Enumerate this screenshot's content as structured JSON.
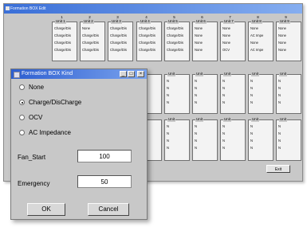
{
  "background_window": {
    "title": "Formation BOX Edit",
    "column_numbers": [
      "1",
      "2",
      "3",
      "4",
      "5",
      "6",
      "7",
      "8",
      "9"
    ],
    "top_units": [
      {
        "label": "Unit 1",
        "rows": [
          "Charge/Dis",
          "Charge/Dis",
          "Charge/Dis",
          "Charge/Dis"
        ]
      },
      {
        "label": "Unit 2",
        "rows": [
          "None",
          "Charge/Dis",
          "Charge/Dis",
          "Charge/Dis"
        ]
      },
      {
        "label": "Unit 3",
        "rows": [
          "Charge/Dis",
          "Charge/Dis",
          "Charge/Dis",
          "Charge/Dis"
        ]
      },
      {
        "label": "Unit 4",
        "rows": [
          "Charge/Dis",
          "Charge/Dis",
          "Charge/Dis",
          "Charge/Dis"
        ]
      },
      {
        "label": "Unit 5",
        "rows": [
          "Charge/Dis",
          "Charge/Dis",
          "Charge/Dis",
          "Charge/Dis"
        ]
      },
      {
        "label": "Unit 6",
        "rows": [
          "None",
          "None",
          "None",
          "None"
        ]
      },
      {
        "label": "Unit 7",
        "rows": [
          "None",
          "None",
          "None",
          "OCV"
        ]
      },
      {
        "label": "Unit 8",
        "rows": [
          "None",
          "AC Impe",
          "None",
          "AC Impe"
        ]
      },
      {
        "label": "Unit 9",
        "rows": [
          "None",
          "None",
          "None",
          "None"
        ]
      }
    ],
    "mid_units": [
      {
        "label": "Unit",
        "rows": [
          "N",
          "N",
          "N",
          "N"
        ]
      },
      {
        "label": "Unit",
        "rows": [
          "N",
          "N",
          "N",
          "N"
        ]
      },
      {
        "label": "Unit",
        "rows": [
          "N",
          "N",
          "N",
          "N"
        ]
      },
      {
        "label": "Unit",
        "rows": [
          "N",
          "N",
          "N",
          "N"
        ]
      },
      {
        "label": "Unit",
        "rows": [
          "N",
          "N",
          "N",
          "N"
        ]
      },
      {
        "label": "Unit",
        "rows": [
          "N",
          "N",
          "N",
          "N"
        ]
      }
    ],
    "low_units": [
      {
        "label": "Unit",
        "rows": [
          "N",
          "N",
          "N",
          "N"
        ]
      },
      {
        "label": "Unit",
        "rows": [
          "N",
          "N",
          "N",
          "N"
        ]
      },
      {
        "label": "Unit",
        "rows": [
          "N",
          "N",
          "N",
          "N"
        ]
      },
      {
        "label": "Unit",
        "rows": [
          "N",
          "N",
          "N",
          "N"
        ]
      },
      {
        "label": "Unit",
        "rows": [
          "N",
          "N",
          "N",
          "N"
        ]
      },
      {
        "label": "Unit",
        "rows": [
          "N",
          "N",
          "N",
          "N"
        ]
      }
    ],
    "exit_label": "Exit"
  },
  "dialog": {
    "title": "Formation BOX Kind",
    "minimize_glyph": "_",
    "maximize_glyph": "□",
    "close_glyph": "×",
    "options": [
      {
        "label": "None",
        "selected": false
      },
      {
        "label": "Charge/DisCharge",
        "selected": true
      },
      {
        "label": "OCV",
        "selected": false
      },
      {
        "label": "AC Impedance",
        "selected": false
      }
    ],
    "fan_start_label": "Fan_Start",
    "fan_start_value": "100",
    "emergency_label": "Emergency",
    "emergency_value": "50",
    "ok_label": "OK",
    "cancel_label": "Cancel"
  },
  "colors": {
    "title_bar": "#2d5ed0",
    "window_face": "#c8c8c8"
  }
}
